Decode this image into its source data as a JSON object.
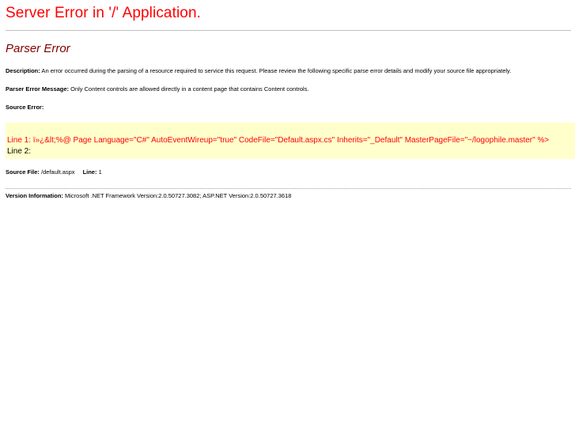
{
  "header": {
    "title": "Server Error in '/' Application."
  },
  "error": {
    "heading": "Parser Error",
    "description_label": "Description:",
    "description_text": " An error occurred during the parsing of a resource required to service this request. Please review the following specific parse error details and modify your source file appropriately.",
    "message_label": "Parser Error Message:",
    "message_text": " Only Content controls are allowed directly in a content page that contains Content controls.",
    "source_error_label": "Source Error:",
    "code_lines": [
      "Line 1:  ï»¿&lt;%@ Page Language=\"C#\" AutoEventWireup=\"true\"  CodeFile=\"Default.aspx.cs\" Inherits=\"_Default\" MasterPageFile=\"~/logophile.master\" %>",
      "Line 2:"
    ],
    "source_file_label": "Source File:",
    "source_file_value": " /default.aspx",
    "line_label": "Line:",
    "line_value": " 1"
  },
  "footer": {
    "version_label": "Version Information:",
    "version_text": " Microsoft .NET Framework Version:2.0.50727.3082; ASP.NET Version:2.0.50727.3618"
  },
  "colors": {
    "title": "#ff0000",
    "heading": "#800000",
    "code_background": "#ffffcc",
    "code_error_line": "#ff0000"
  }
}
